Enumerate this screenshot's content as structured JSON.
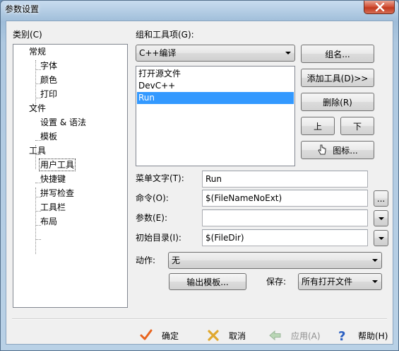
{
  "window": {
    "title": "参数设置"
  },
  "category": {
    "label": "类别(C)",
    "tree": [
      {
        "label": "常规",
        "level": 0
      },
      {
        "label": "字体",
        "level": 1
      },
      {
        "label": "颜色",
        "level": 1
      },
      {
        "label": "打印",
        "level": 1
      },
      {
        "label": "文件",
        "level": 0
      },
      {
        "label": "设置 & 语法",
        "level": 1
      },
      {
        "label": "模板",
        "level": 1
      },
      {
        "label": "工具",
        "level": 0
      },
      {
        "label": "用户工具",
        "level": 1,
        "selected": true
      },
      {
        "label": "快捷键",
        "level": 1
      },
      {
        "label": "拼写检查",
        "level": 1
      },
      {
        "label": "工具栏",
        "level": 1
      },
      {
        "label": "布局",
        "level": 1
      }
    ]
  },
  "group": {
    "label": "组和工具项(G):",
    "selected_group": "C++编译",
    "tools": [
      "打开源文件",
      "DevC++",
      "Run"
    ],
    "selected_tool": "Run"
  },
  "buttons": {
    "group_name": "组名...",
    "add_tool": "添加工具(D)>>",
    "delete": "删除(R)",
    "up": "上",
    "down": "下",
    "icon": "图标...",
    "output_template": "输出模板...",
    "browse": "..."
  },
  "fields": {
    "menu_text_label": "菜单文字(T):",
    "menu_text_value": "Run",
    "command_label": "命令(O):",
    "command_value": "$(FileNameNoExt)",
    "args_label": "参数(E):",
    "args_value": "",
    "initdir_label": "初始目录(I):",
    "initdir_value": "$(FileDir)",
    "action_label": "动作:",
    "action_value": "无",
    "save_label": "保存:",
    "save_value": "所有打开文件"
  },
  "footer": {
    "ok": "确定",
    "cancel": "取消",
    "apply": "应用(A)",
    "help": "帮助(H)"
  },
  "colors": {
    "selection": "#3399ff",
    "ok_icon": "#e8641e",
    "cancel_icon": "#e0a82e",
    "help_icon": "#2a5fc2"
  }
}
